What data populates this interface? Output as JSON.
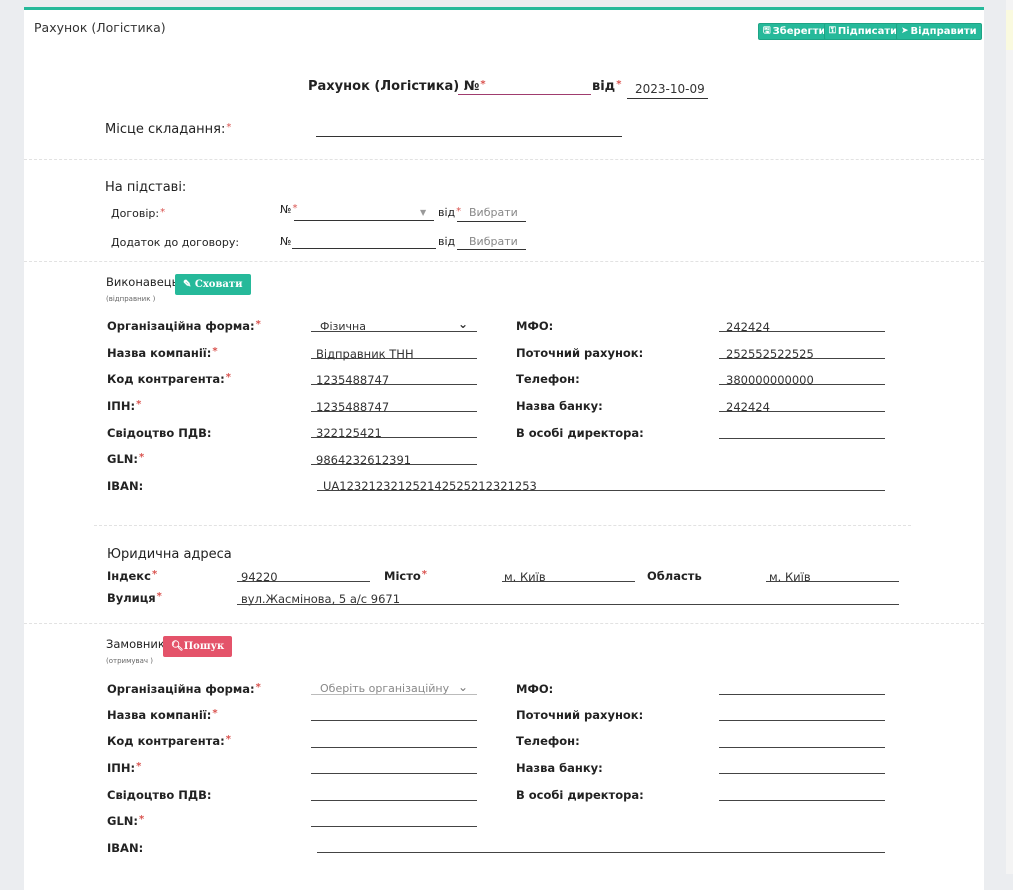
{
  "panel": {
    "title": "Рахунок (Логістика)"
  },
  "toolbar": {
    "save_label": "Зберегти",
    "sign_label": "Підписати",
    "send_label": "Відправити"
  },
  "header": {
    "doc_title": "Рахунок (Логістика) №",
    "from_label": "від",
    "date": "2023-10-09",
    "place_label": "Місце складання:"
  },
  "basis": {
    "title": "На підставі:",
    "contract_label": "Договір:",
    "annex_label": "Додаток до договору:",
    "no_label": "№",
    "from_label": "від",
    "choose_placeholder": "Вибрати"
  },
  "executor": {
    "title": "Виконавець",
    "subtitle": "(відправник )",
    "hide_label": "Сховати",
    "org_form_label": "Організаційна форма:",
    "org_form_value": "Фізична",
    "company_label": "Назва компанії:",
    "company_value": "Відправник ТНН",
    "code_label": "Код контрагента:",
    "code_value": "1235488747",
    "ipn_label": "ІПН:",
    "ipn_value": "1235488747",
    "vat_label": "Свідоцтво ПДВ:",
    "vat_value": "322125421",
    "gln_label": "GLN:",
    "gln_value": "9864232612391",
    "iban_label": "IBAN:",
    "iban_value": "UA123212321252142525212321253",
    "mfo_label": "МФО:",
    "mfo_value": "242424",
    "account_label": "Поточний рахунок:",
    "account_value": "252552522525",
    "phone_label": "Телефон:",
    "phone_value": "380000000000",
    "bank_label": "Назва банку:",
    "bank_value": "242424",
    "director_label": "В особі директора:",
    "director_value": ""
  },
  "address": {
    "title": "Юридична адреса",
    "index_label": "Індекс",
    "index_value": "94220",
    "city_label": "Місто",
    "city_value": "м. Київ",
    "region_label": "Область",
    "region_value": "м. Київ",
    "street_label": "Вулиця",
    "street_value": "вул.Жасмінова, 5 а/с 9671"
  },
  "customer": {
    "title": "Замовник",
    "subtitle": "(отримувач )",
    "search_label": "Пошук",
    "org_form_label": "Організаційна форма:",
    "org_form_placeholder": "Оберіть організаційну фо",
    "company_label": "Назва компанії:",
    "code_label": "Код контрагента:",
    "ipn_label": "ІПН:",
    "vat_label": "Свідоцтво ПДВ:",
    "gln_label": "GLN:",
    "iban_label": "IBAN:",
    "mfo_label": "МФО:",
    "account_label": "Поточний рахунок:",
    "phone_label": "Телефон:",
    "bank_label": "Назва банку:",
    "director_label": "В особі директора:"
  },
  "icons": {
    "save": "floppy-icon",
    "sign": "key-icon",
    "send": "paper-plane-icon",
    "hide": "pencil-icon",
    "search": "magnifier-icon"
  },
  "colors": {
    "accent": "#26b99a",
    "danger": "#e4536a",
    "required": "#d9534f"
  }
}
